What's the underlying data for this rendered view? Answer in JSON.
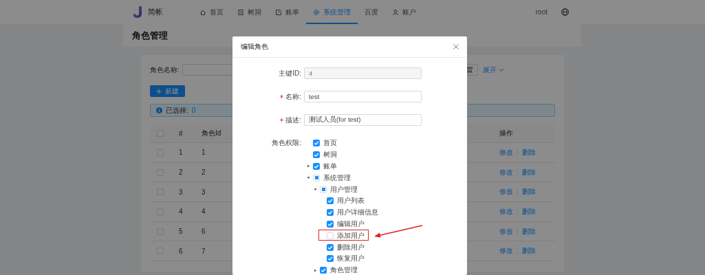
{
  "header": {
    "brand": "简帐",
    "nav": [
      {
        "label": "首页",
        "selected": false
      },
      {
        "label": "树洞",
        "selected": false
      },
      {
        "label": "账单",
        "selected": false
      },
      {
        "label": "系统管理",
        "selected": true
      },
      {
        "label": "百度",
        "selected": false
      },
      {
        "label": "账户",
        "selected": false
      }
    ],
    "user": "root"
  },
  "page_title": "角色管理",
  "search": {
    "label": "角色名称:",
    "reset_button": "置",
    "expand_link": "展开"
  },
  "new_button": "新建",
  "selection_alert": {
    "label": "已选择:",
    "count": "0"
  },
  "table": {
    "header_checked": false,
    "columns": [
      "#",
      "角色Id",
      "操作"
    ],
    "rows": [
      {
        "index": "1",
        "role_id": "1",
        "actions": [
          "修改",
          "删除"
        ],
        "selected": false
      },
      {
        "index": "2",
        "role_id": "2",
        "actions": [
          "修改",
          "删除"
        ],
        "selected": false
      },
      {
        "index": "3",
        "role_id": "3",
        "actions": [
          "修改",
          "删除"
        ],
        "selected": false
      },
      {
        "index": "4",
        "role_id": "4",
        "actions": [
          "修改",
          "删除"
        ],
        "selected": false
      },
      {
        "index": "5",
        "role_id": "6",
        "actions": [
          "修改",
          "删除"
        ],
        "selected": false
      },
      {
        "index": "6",
        "role_id": "7",
        "actions": [
          "修改",
          "删除"
        ],
        "selected": false
      }
    ]
  },
  "modal": {
    "title": "编辑角色",
    "fields": [
      {
        "label": "主键ID:",
        "value": "4",
        "required": false,
        "disabled": true
      },
      {
        "label": "名称:",
        "value": "test",
        "required": true,
        "disabled": false
      },
      {
        "label": "描述:",
        "value": "测试人员(for test)",
        "required": true,
        "disabled": false
      }
    ],
    "permissions_label": "角色权限:",
    "tree": [
      {
        "label": "首页",
        "checked": true,
        "indeterminate": false,
        "highlighted": false
      },
      {
        "label": "树洞",
        "checked": true,
        "indeterminate": false,
        "highlighted": false
      },
      {
        "label": "账单",
        "checked": true,
        "indeterminate": false,
        "highlighted": false,
        "expanded": false
      },
      {
        "label": "系统管理",
        "checked": false,
        "indeterminate": true,
        "highlighted": false,
        "expanded": true,
        "children": [
          {
            "label": "用户管理",
            "checked": false,
            "indeterminate": true,
            "highlighted": false,
            "expanded": true,
            "children": [
              {
                "label": "用户列表",
                "checked": true,
                "indeterminate": false,
                "highlighted": false
              },
              {
                "label": "用户详细信息",
                "checked": true,
                "indeterminate": false,
                "highlighted": false
              },
              {
                "label": "编辑用户",
                "checked": true,
                "indeterminate": false,
                "highlighted": false
              },
              {
                "label": "添加用户",
                "checked": false,
                "indeterminate": false,
                "highlighted": true
              },
              {
                "label": "删除用户",
                "checked": true,
                "indeterminate": false,
                "highlighted": false
              },
              {
                "label": "恢复用户",
                "checked": true,
                "indeterminate": false,
                "highlighted": false
              }
            ]
          },
          {
            "label": "角色管理",
            "checked": true,
            "indeterminate": false,
            "highlighted": false,
            "expanded": false
          }
        ]
      }
    ]
  }
}
